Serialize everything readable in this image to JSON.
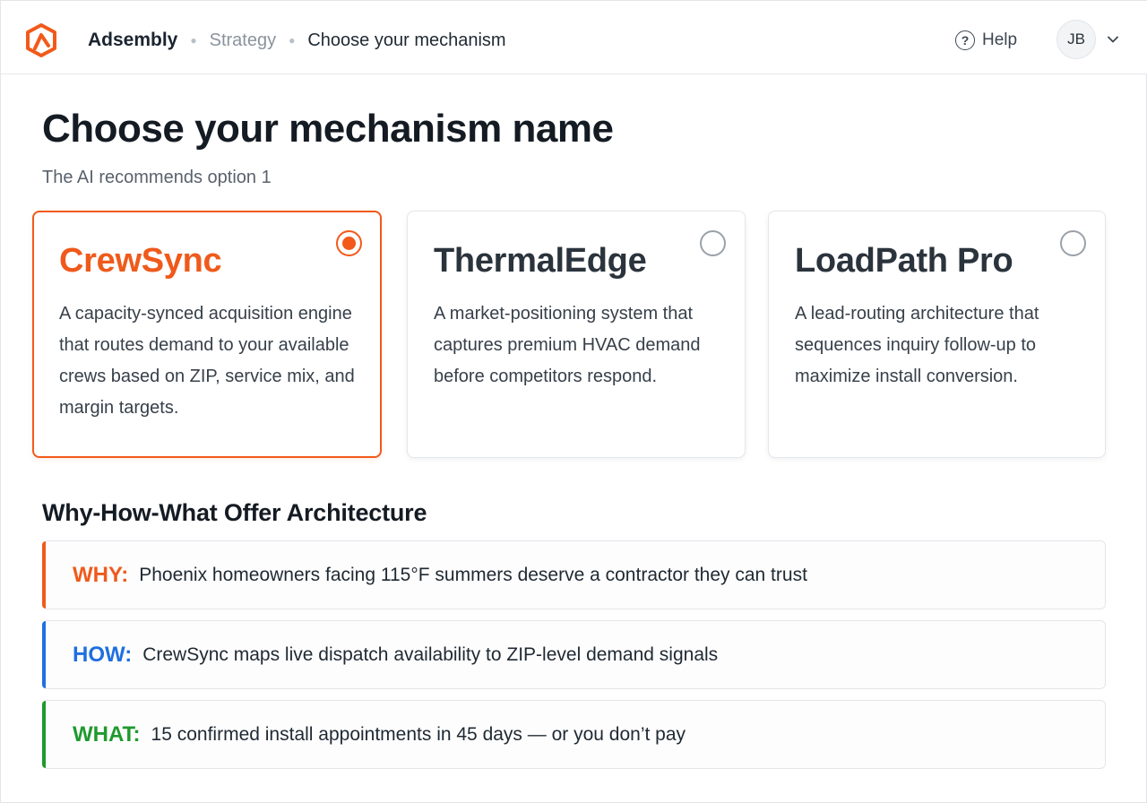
{
  "header": {
    "brand": "Adsembly",
    "breadcrumb_parent": "Strategy",
    "breadcrumb_current": "Choose your mechanism",
    "help_label": "Help",
    "avatar_initials": "JB",
    "icons": [
      "logo-icon",
      "help-icon",
      "chevron-down-icon"
    ]
  },
  "page": {
    "title": "Choose your mechanism name",
    "subtitle": "The AI recommends option 1"
  },
  "options": [
    {
      "title": "CrewSync",
      "description": "A capacity-synced acquisition engine that routes demand to your available crews based on ZIP, service mix, and margin targets.",
      "selected": true
    },
    {
      "title": "ThermalEdge",
      "description": "A market-positioning system that captures premium HVAC demand before competitors respond.",
      "selected": false
    },
    {
      "title": "LoadPath Pro",
      "description": "A lead-routing architecture that sequences inquiry follow-up to maximize install conversion.",
      "selected": false
    }
  ],
  "architecture": {
    "title": "Why-How-What Offer Architecture",
    "rows": [
      {
        "label": "WHY:",
        "text": "Phoenix homeowners facing 115°F summers deserve a contractor they can trust",
        "color": "#ef5a1c"
      },
      {
        "label": "HOW:",
        "text": "CrewSync maps live dispatch availability to ZIP-level demand signals",
        "color": "#1f6fe0"
      },
      {
        "label": "WHAT:",
        "text": "15 confirmed install appointments in 45 days — or you don’t pay",
        "color": "#1f9a2e"
      }
    ]
  },
  "colors": {
    "accent": "#f15a1a",
    "why": "#ef5a1c",
    "how": "#1f6fe0",
    "what": "#1f9a2e"
  }
}
